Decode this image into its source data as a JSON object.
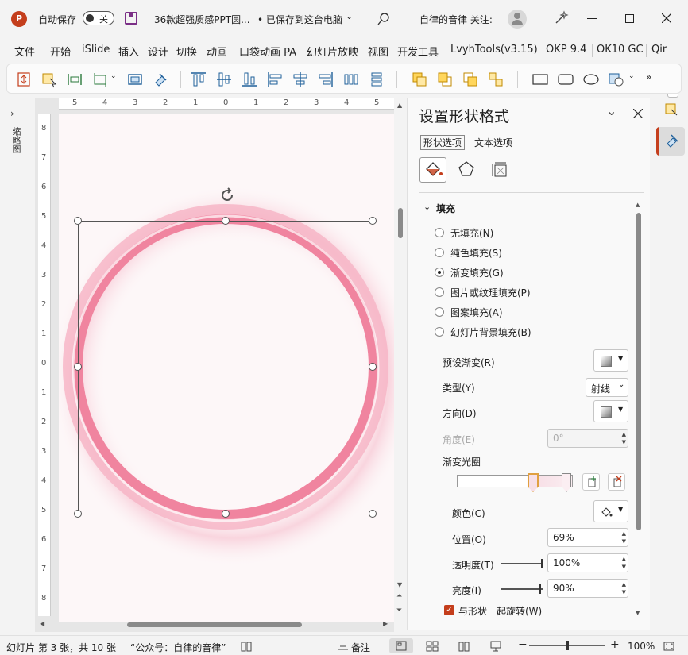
{
  "titlebar": {
    "autosave_label": "自动保存",
    "autosave_state": "关",
    "doc_title": "36款超强质感PPT圆...",
    "save_status": "• 已保存到这台电脑",
    "user_label": "自律的音律 关注:"
  },
  "menu": [
    "文件",
    "开始",
    "iSlide",
    "插入",
    "设计",
    "切换",
    "动画",
    "口袋动画 PA",
    "幻灯片放映",
    "视图",
    "开发工具",
    "LvyhTools(v3.15)",
    "OKP 9.4",
    "OK10 GC",
    "Qir"
  ],
  "left_panel": {
    "label": "缩略图"
  },
  "ruler": {
    "h_ticks": [
      "5",
      "4",
      "3",
      "2",
      "1",
      "0",
      "1",
      "2",
      "3",
      "4",
      "5"
    ],
    "v_ticks": [
      "8",
      "7",
      "6",
      "5",
      "4",
      "3",
      "2",
      "1",
      "0",
      "1",
      "2",
      "3",
      "4",
      "5",
      "6",
      "7",
      "8"
    ]
  },
  "pane": {
    "title": "设置形状格式",
    "tab_shape": "形状选项",
    "tab_text": "文本选项",
    "section_fill": "填充",
    "fill_options": [
      "无填充(N)",
      "纯色填充(S)",
      "渐变填充(G)",
      "图片或纹理填充(P)",
      "图案填充(A)",
      "幻灯片背景填充(B)"
    ],
    "selected_fill_index": 2,
    "preset_label": "预设渐变(R)",
    "type_label": "类型(Y)",
    "type_value": "射线",
    "direction_label": "方向(D)",
    "angle_label": "角度(E)",
    "angle_value": "0°",
    "stops_label": "渐变光圈",
    "color_label": "颜色(C)",
    "position_label": "位置(O)",
    "position_value": "69%",
    "transparency_label": "透明度(T)",
    "transparency_value": "100%",
    "brightness_label": "亮度(I)",
    "brightness_value": "90%",
    "rotate_label": "与形状一起旋转(W)",
    "rotate_checked": true
  },
  "status": {
    "slide_info": "幻灯片 第 3 张，共 10 张",
    "account": "“公众号：自律的音律”",
    "notes": "备注",
    "zoom": "100%"
  },
  "colors": {
    "accent": "#c43e1c",
    "ring_pink": "#f0849f",
    "ring_light": "#f6b3c4"
  }
}
